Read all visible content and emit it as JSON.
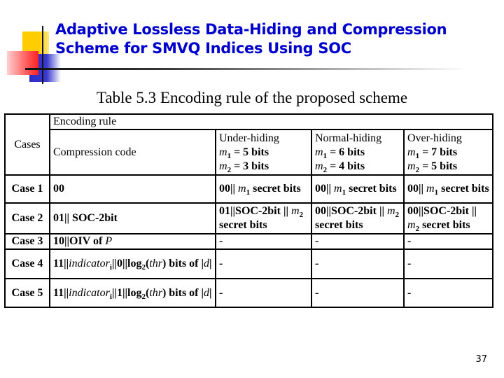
{
  "slide": {
    "title_lines": [
      "Adaptive Lossless Data-Hiding and Compression",
      "Scheme for SMVQ Indices Using SOC"
    ],
    "page_number": "37",
    "title_color": "#0000cc"
  },
  "table": {
    "caption": "Table 5.3 Encoding rule of the proposed scheme",
    "group_header": "Encoding rule",
    "cases_header": "Cases",
    "compression_header": "Compression code",
    "mode_headers": [
      {
        "name": "Under-hiding",
        "m1": "m1 = 5 bits",
        "m1_var": "m",
        "m1_sub": "1",
        "m1_text": " = 5 bits",
        "m2_var": "m",
        "m2_sub": "2",
        "m2_text": " = 3 bits"
      },
      {
        "name": "Normal-hiding",
        "m1_var": "m",
        "m1_sub": "1",
        "m1_text": " = 6 bits",
        "m2_var": "m",
        "m2_sub": "2",
        "m2_text": " = 4 bits"
      },
      {
        "name": "Over-hiding",
        "m1_var": "m",
        "m1_sub": "1",
        "m1_text": " = 7 bits",
        "m2_var": "m",
        "m2_sub": "2",
        "m2_text": " = 5 bits"
      }
    ],
    "rows": [
      {
        "case": "Case 1",
        "code": "00",
        "under": {
          "pre": "00|| ",
          "var": "m",
          "sub": "1",
          "post": " secret bits"
        },
        "normal": {
          "pre": "00|| ",
          "var": "m",
          "sub": "1",
          "post": " secret bits"
        },
        "over": {
          "pre": "00|| ",
          "var": "m",
          "sub": "1",
          "post": " secret bits"
        }
      },
      {
        "case": "Case 2",
        "code": "01|| SOC-2bit",
        "under": {
          "pre": "01||SOC-2bit || ",
          "var": "m",
          "sub": "2",
          "post": " secret bits"
        },
        "normal": {
          "pre": "00||SOC-2bit || ",
          "var": "m",
          "sub": "2",
          "post": " secret bits"
        },
        "over": {
          "pre": "00||SOC-2bit || ",
          "var": "m",
          "sub": "2",
          "post": " secret bits"
        }
      },
      {
        "case": "Case 3",
        "code_pre": "10||OIV  of ",
        "code_var": "P",
        "under": "-",
        "normal": "-",
        "over": "-"
      },
      {
        "case": "Case 4",
        "code_pre": "11||",
        "code_var": "indicator",
        "code_sub": "i",
        "code_mid": "||0||log",
        "code_sub2": "2",
        "code_paren_open": "(",
        "code_var2": "thr",
        "code_post": ") bits of |",
        "code_var3": "d",
        "code_end": "|",
        "under": "-",
        "normal": "-",
        "over": "-"
      },
      {
        "case": "Case 5",
        "code_pre": "11||",
        "code_var": "indicator",
        "code_sub": "i",
        "code_mid": "||1||log",
        "code_sub2": "2",
        "code_paren_open": "(",
        "code_var2": "thr",
        "code_post": ") bits of |",
        "code_var3": "d",
        "code_end": "|",
        "under": "-",
        "normal": "-",
        "over": "-"
      }
    ]
  }
}
